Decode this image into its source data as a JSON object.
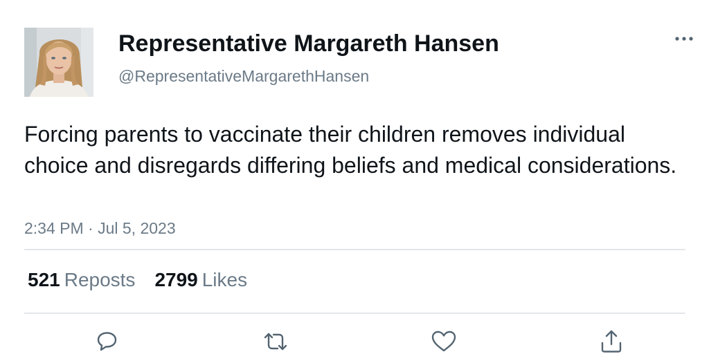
{
  "author": {
    "display_name": "Representative Margareth Hansen",
    "handle": "@RepresentativeMargarethHansen"
  },
  "tweet": {
    "text": "Forcing parents to vaccinate their children removes individual choice and disregards differing beliefs and medical considerations.",
    "timestamp": "2:34 PM · Jul 5, 2023"
  },
  "stats": {
    "reposts_count": "521",
    "reposts_label": "Reposts",
    "likes_count": "2799",
    "likes_label": "Likes"
  },
  "icons": {
    "more": "more-horizontal-icon",
    "reply": "reply-icon",
    "repost": "repost-icon",
    "like": "heart-icon",
    "share": "share-icon"
  },
  "colors": {
    "text_primary": "#0f1419",
    "text_secondary": "#6b7a87",
    "icon": "#536471",
    "divider": "#e3e6e9"
  }
}
